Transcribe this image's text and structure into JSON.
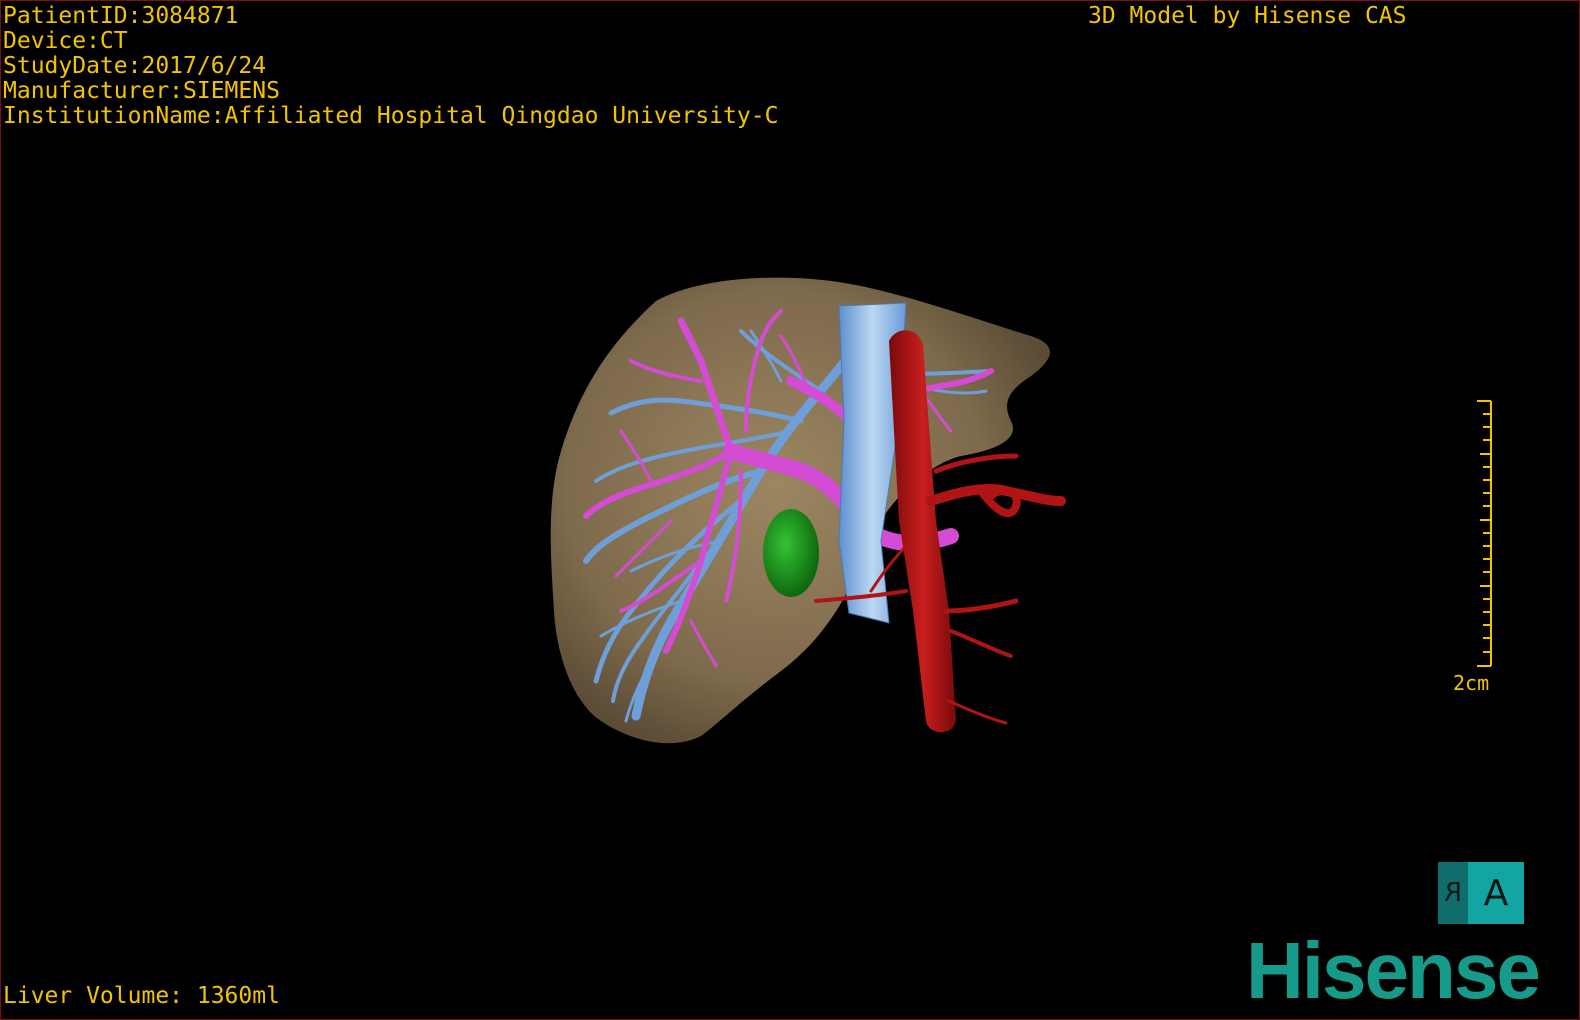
{
  "header_info": {
    "patient_id": "PatientID:3084871",
    "device": "Device:CT",
    "study_date": "StudyDate:2017/6/24",
    "manufacturer": "Manufacturer:SIEMENS",
    "institution": "InstitutionName:Affiliated Hospital Qingdao University-C"
  },
  "credit": "3D Model by Hisense CAS",
  "scale_bar": {
    "label": "2cm"
  },
  "orientation_cube": {
    "side_letter": "R",
    "front_letter": "A",
    "side_color": "#0f6e6c",
    "front_color": "#13a5a2"
  },
  "brand": "Hisense",
  "footer": {
    "liver_volume": "Liver Volume: 1360ml"
  },
  "model_colors": {
    "liver": "#8a7456",
    "hepatic_vein": "#6f9fd8",
    "portal_vein": "#d34cd3",
    "inferior_vena_cava": "#8fb9e6",
    "artery": "#b01414",
    "gallbladder": "#1f9a1f",
    "text_overlay": "#f2c400"
  }
}
